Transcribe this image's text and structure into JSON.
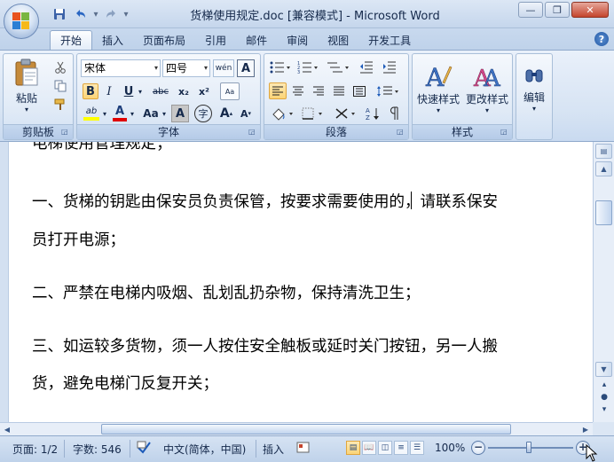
{
  "window": {
    "title": "货梯使用规定.doc [兼容模式] - Microsoft Word",
    "minimize_glyph": "—",
    "restore_glyph": "❐",
    "close_glyph": "✕"
  },
  "quick_access": {
    "save_icon": "save-icon",
    "undo_icon": "undo-icon",
    "redo_icon": "redo-icon",
    "customize_icon": "customize-icon"
  },
  "tabs": [
    {
      "label": "开始",
      "active": true
    },
    {
      "label": "插入"
    },
    {
      "label": "页面布局"
    },
    {
      "label": "引用"
    },
    {
      "label": "邮件"
    },
    {
      "label": "审阅"
    },
    {
      "label": "视图"
    },
    {
      "label": "开发工具"
    }
  ],
  "help_glyph": "?",
  "ribbon": {
    "clipboard": {
      "label": "剪贴板",
      "paste_label": "粘贴",
      "dropdown_glyph": "▾"
    },
    "font": {
      "label": "字体",
      "font_name": "宋体",
      "font_size": "四号",
      "wen_glyph": "wén",
      "bold": "B",
      "italic": "I",
      "underline": "U",
      "strike": "abc",
      "subscript": "x₂",
      "superscript": "x²",
      "clear_glyph": "Aa",
      "highlight_glyph": "ab",
      "font_color_glyph": "A",
      "case_glyph": "Aa",
      "char_shading_glyph": "A",
      "enclose_glyph": "字",
      "grow_glyph": "A",
      "shrink_glyph": "A",
      "font_box_glyph": "A"
    },
    "paragraph": {
      "label": "段落"
    },
    "styles": {
      "label": "样式",
      "quick_styles": "快速样式",
      "change_styles": "更改样式"
    },
    "editing": {
      "label": "编辑"
    }
  },
  "document": {
    "lines": [
      "电梯使用管理规定；",
      "一、货梯的钥匙由保安员负责保管，按要求需要使用的，请联系保安",
      "员打开电源；",
      "二、严禁在电梯内吸烟、乱划乱扔杂物，保持清洗卫生；",
      "三、如运较多货物，须一人按住安全触板或延时关门按钮，另一人搬",
      "货，避免电梯门反复开关；"
    ]
  },
  "status": {
    "page": "页面: 1/2",
    "words": "字数: 546",
    "language": "中文(简体，中国)",
    "insert_mode": "插入",
    "zoom": "100%",
    "zoom_level_percent": 100
  },
  "colors": {
    "highlight": "#ffff00",
    "font_color": "#e00000",
    "accent_selected": "#fbd477"
  }
}
